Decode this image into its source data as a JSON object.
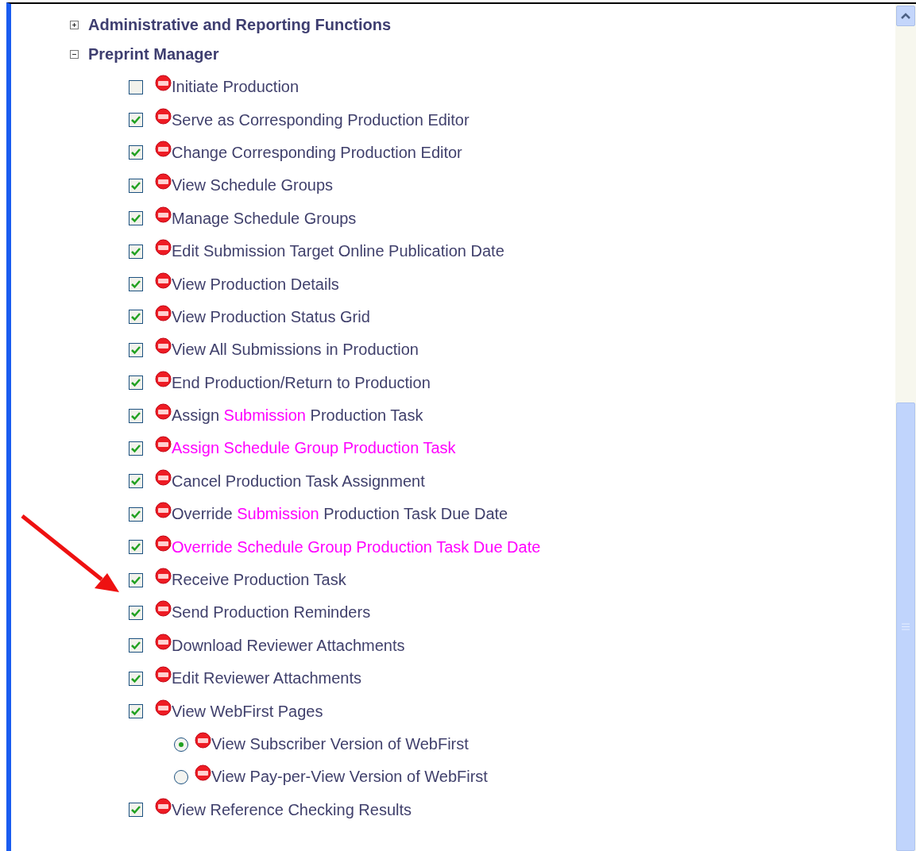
{
  "sections": [
    {
      "title": "Administrative and Reporting Functions",
      "expanded": false
    },
    {
      "title": "Preprint Manager",
      "expanded": true,
      "permissions": [
        {
          "kind": "checkbox",
          "checked": false,
          "label": [
            {
              "text": "Initiate Production",
              "highlighted": false
            }
          ]
        },
        {
          "kind": "checkbox",
          "checked": true,
          "label": [
            {
              "text": "Serve as Corresponding Production Editor",
              "highlighted": false
            }
          ]
        },
        {
          "kind": "checkbox",
          "checked": true,
          "label": [
            {
              "text": "Change Corresponding Production Editor",
              "highlighted": false
            }
          ]
        },
        {
          "kind": "checkbox",
          "checked": true,
          "label": [
            {
              "text": "View Schedule Groups",
              "highlighted": false
            }
          ]
        },
        {
          "kind": "checkbox",
          "checked": true,
          "label": [
            {
              "text": "Manage Schedule Groups",
              "highlighted": false
            }
          ]
        },
        {
          "kind": "checkbox",
          "checked": true,
          "label": [
            {
              "text": "Edit Submission Target Online Publication Date",
              "highlighted": false
            }
          ]
        },
        {
          "kind": "checkbox",
          "checked": true,
          "label": [
            {
              "text": "View Production Details",
              "highlighted": false
            }
          ]
        },
        {
          "kind": "checkbox",
          "checked": true,
          "label": [
            {
              "text": "View Production Status Grid",
              "highlighted": false
            }
          ]
        },
        {
          "kind": "checkbox",
          "checked": true,
          "label": [
            {
              "text": "View All Submissions in Production",
              "highlighted": false
            }
          ]
        },
        {
          "kind": "checkbox",
          "checked": true,
          "label": [
            {
              "text": "End Production/Return to Production",
              "highlighted": false
            }
          ]
        },
        {
          "kind": "checkbox",
          "checked": true,
          "label": [
            {
              "text": "Assign ",
              "highlighted": false
            },
            {
              "text": "Submission",
              "highlighted": true
            },
            {
              "text": " Production Task",
              "highlighted": false
            }
          ]
        },
        {
          "kind": "checkbox",
          "checked": true,
          "label": [
            {
              "text": "Assign Schedule Group Production Task",
              "highlighted": true
            }
          ]
        },
        {
          "kind": "checkbox",
          "checked": true,
          "label": [
            {
              "text": "Cancel Production Task Assignment",
              "highlighted": false
            }
          ]
        },
        {
          "kind": "checkbox",
          "checked": true,
          "label": [
            {
              "text": "Override ",
              "highlighted": false
            },
            {
              "text": "Submission",
              "highlighted": true
            },
            {
              "text": " Production Task Due Date",
              "highlighted": false
            }
          ]
        },
        {
          "kind": "checkbox",
          "checked": true,
          "label": [
            {
              "text": "Override Schedule Group Production Task Due Date",
              "highlighted": true
            }
          ]
        },
        {
          "kind": "checkbox",
          "checked": true,
          "label": [
            {
              "text": "Receive Production Task",
              "highlighted": false
            }
          ]
        },
        {
          "kind": "checkbox",
          "checked": true,
          "label": [
            {
              "text": "Send Production Reminders",
              "highlighted": false
            }
          ]
        },
        {
          "kind": "checkbox",
          "checked": true,
          "label": [
            {
              "text": "Download Reviewer Attachments",
              "highlighted": false
            }
          ]
        },
        {
          "kind": "checkbox",
          "checked": true,
          "label": [
            {
              "text": "Edit Reviewer Attachments",
              "highlighted": false
            }
          ]
        },
        {
          "kind": "checkbox",
          "checked": true,
          "label": [
            {
              "text": "View WebFirst Pages",
              "highlighted": false
            }
          ],
          "children": [
            {
              "kind": "radio",
              "selected": true,
              "label": [
                {
                  "text": "View Subscriber Version of WebFirst",
                  "highlighted": false
                }
              ]
            },
            {
              "kind": "radio",
              "selected": false,
              "label": [
                {
                  "text": "View Pay-per-View Version of WebFirst",
                  "highlighted": false
                }
              ]
            }
          ]
        },
        {
          "kind": "checkbox",
          "checked": true,
          "label": [
            {
              "text": "View Reference Checking Results",
              "highlighted": false
            }
          ]
        }
      ]
    }
  ]
}
